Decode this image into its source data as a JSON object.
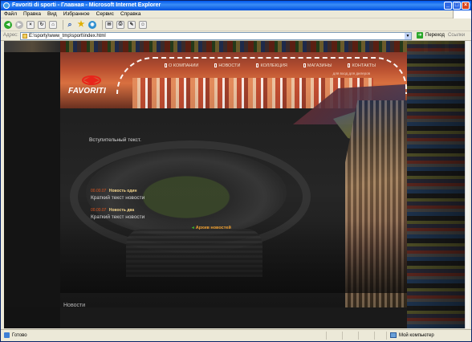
{
  "window": {
    "title": "Favoriti di sporti - Главная - Microsoft Internet Explorer"
  },
  "menu": [
    "Файл",
    "Правка",
    "Вид",
    "Избранное",
    "Сервис",
    "Справка"
  ],
  "address": {
    "label": "Адрес:",
    "url": "E:\\sporty\\www_tmp\\sport\\index.html",
    "go_label": "Переход",
    "links_label": "Ссылки"
  },
  "site": {
    "logo_text": "FAVORITI",
    "nav": [
      "О КОМПАНИИ",
      "НОВОСТИ",
      "КОЛЛЕКЦИЯ",
      "МАГАЗИНЫ",
      "КОНТАКТЫ"
    ],
    "nav_sub": "для вход для дилеров",
    "intro_text": "Вступительный текст.",
    "news": [
      {
        "date": "00.00.07",
        "title": "Новость один",
        "text": "Краткий текст новости"
      },
      {
        "date": "00.00.07",
        "title": "Новость два",
        "text": "Краткий текст новости"
      }
    ],
    "archive_label": "Архив новостей",
    "bottom_title": "Новости",
    "accent_color": "#e0561f"
  },
  "status": {
    "left_text": "Готово",
    "right_text": "Мой компьютер"
  }
}
